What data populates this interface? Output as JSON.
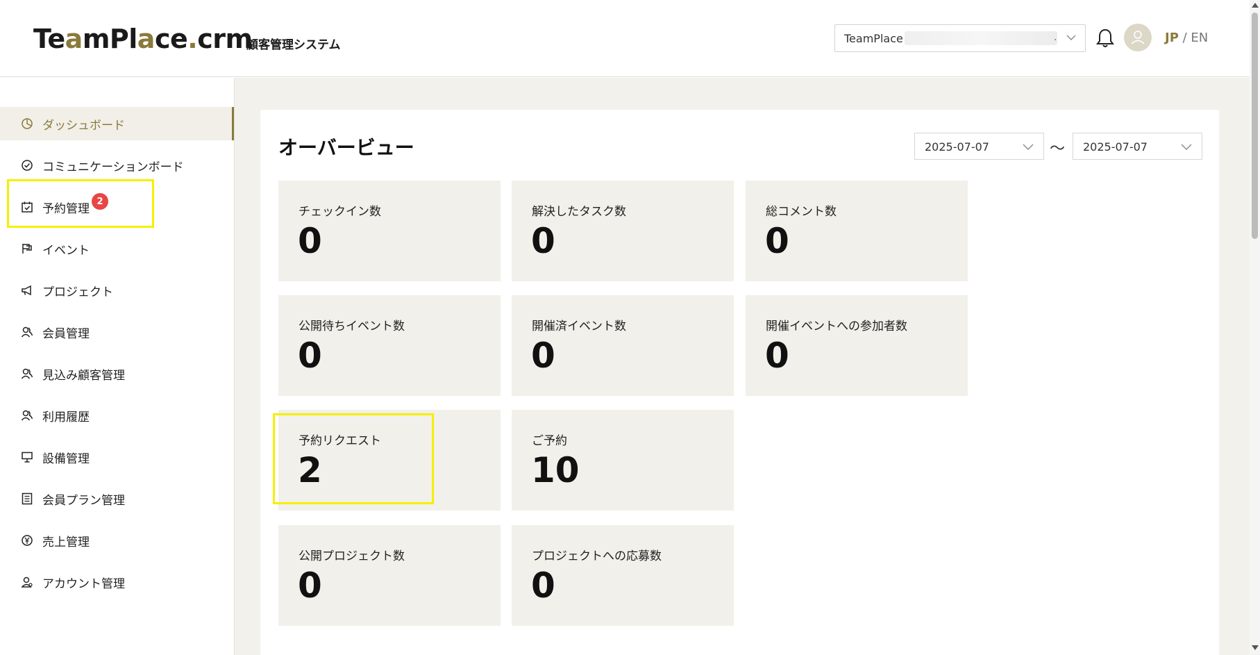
{
  "header": {
    "logo_pre": "Te",
    "logo_a": "a",
    "logo_mid": "mPl",
    "logo_a2": "a",
    "logo_post": "ce",
    "logo_dot": ".",
    "logo_crm": "crm",
    "subtitle": "顧客管理システム",
    "tenant_value": "TeamPlace",
    "tenant_suffix": ".",
    "lang_jp": "JP",
    "lang_sep": " / ",
    "lang_en": "EN"
  },
  "sidebar": {
    "items": [
      {
        "label": "ダッシュボード",
        "icon": "pie-chart-icon",
        "active": true
      },
      {
        "label": "コミュニケーションボード",
        "icon": "check-circle-icon"
      },
      {
        "label": "予約管理",
        "icon": "calendar-check-icon",
        "badge": "2"
      },
      {
        "label": "イベント",
        "icon": "flag-icon"
      },
      {
        "label": "プロジェクト",
        "icon": "megaphone-icon"
      },
      {
        "label": "会員管理",
        "icon": "users-icon"
      },
      {
        "label": "見込み顧客管理",
        "icon": "users-icon"
      },
      {
        "label": "利用履歴",
        "icon": "users-icon"
      },
      {
        "label": "設備管理",
        "icon": "presentation-icon"
      },
      {
        "label": "会員プラン管理",
        "icon": "list-icon"
      },
      {
        "label": "売上管理",
        "icon": "yen-circle-icon"
      },
      {
        "label": "アカウント管理",
        "icon": "user-gear-icon"
      }
    ]
  },
  "main": {
    "title": "オーバービュー",
    "date_from": "2025-07-07",
    "date_to": "2025-07-07",
    "date_sep": "〜",
    "stats": [
      {
        "label": "チェックイン数",
        "value": "0"
      },
      {
        "label": "解決したタスク数",
        "value": "0"
      },
      {
        "label": "総コメント数",
        "value": "0"
      },
      {
        "label": "公開待ちイベント数",
        "value": "0"
      },
      {
        "label": "開催済イベント数",
        "value": "0"
      },
      {
        "label": "開催イベントへの参加者数",
        "value": "0"
      },
      {
        "label": "予約リクエスト",
        "value": "2"
      },
      {
        "label": "ご予約",
        "value": "10"
      },
      {
        "label": "公開プロジェクト数",
        "value": "0"
      },
      {
        "label": "プロジェクトへの応募数",
        "value": "0"
      }
    ]
  },
  "colors": {
    "accent": "#8a7a3a",
    "highlight": "#f5f000",
    "badge": "#e84545",
    "card_bg": "#f2f0ea"
  }
}
